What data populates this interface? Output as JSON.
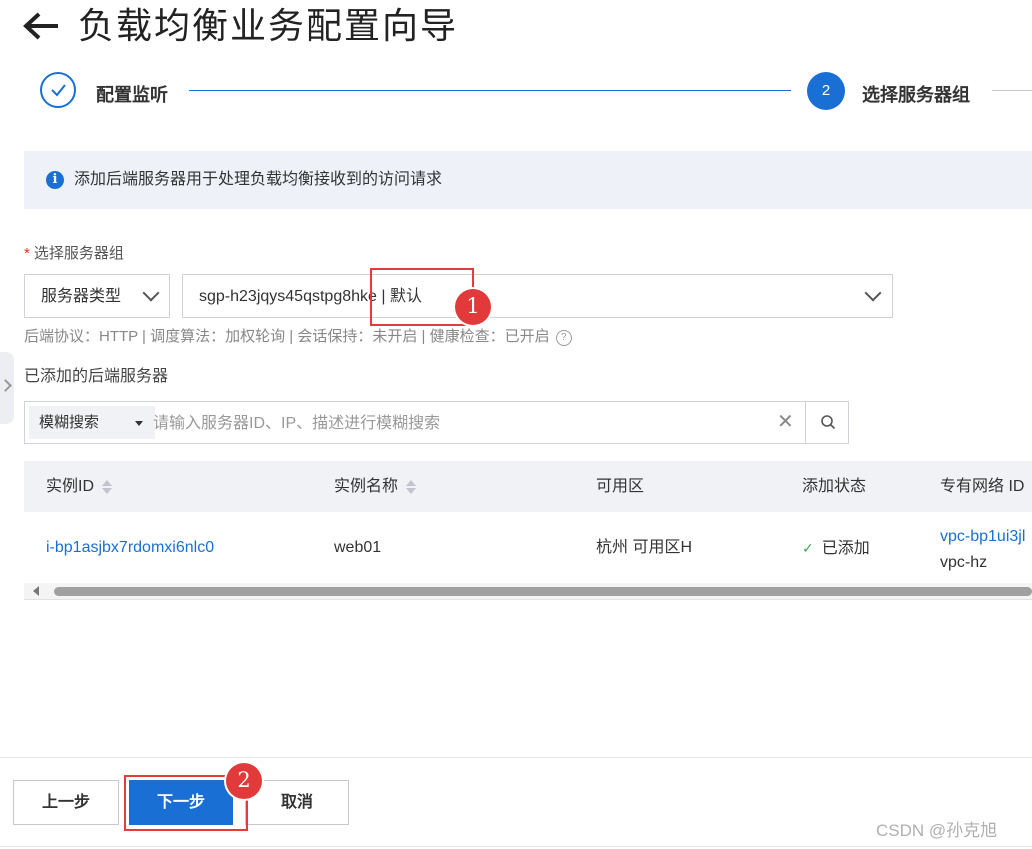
{
  "header": {
    "title": "负载均衡业务配置向导"
  },
  "steps": [
    {
      "number": "",
      "label": "配置监听",
      "state": "done"
    },
    {
      "number": "2",
      "label": "选择服务器组",
      "state": "active"
    }
  ],
  "banner": {
    "text": "添加后端服务器用于处理负载均衡接收到的访问请求"
  },
  "server_group": {
    "required_mark": "*",
    "label": "选择服务器组",
    "type_select": "服务器类型",
    "group_select": "sgp-h23jqys45qstpg8hke | 默认",
    "meta": "后端协议：HTTP | 调度算法：加权轮询 | 会话保持：未开启 | 健康检查：已开启"
  },
  "added_servers": {
    "label": "已添加的后端服务器",
    "search_mode": "模糊搜索",
    "search_placeholder": "请输入服务器ID、IP、描述进行模糊搜索",
    "search_value": ""
  },
  "table": {
    "columns": [
      "实例ID",
      "实例名称",
      "可用区",
      "添加状态",
      "专有网络 ID"
    ],
    "rows": [
      {
        "instance_id": "i-bp1asjbx7rdomxi6nlc0",
        "instance_name": "web01",
        "zone": "杭州 可用区H",
        "status": "已添加",
        "vpc_id": "vpc-bp1ui3jl",
        "vpc_name": "vpc-hz"
      }
    ]
  },
  "annotations": {
    "badge1": "1",
    "badge2": "2"
  },
  "footer": {
    "prev_label": "上一步",
    "next_label": "下一步",
    "cancel_label": "取消"
  },
  "watermark": "CSDN @孙克旭",
  "colors": {
    "primary": "#1a6fd4",
    "annotation_red": "#e23a3a",
    "success": "#3aa55c"
  }
}
